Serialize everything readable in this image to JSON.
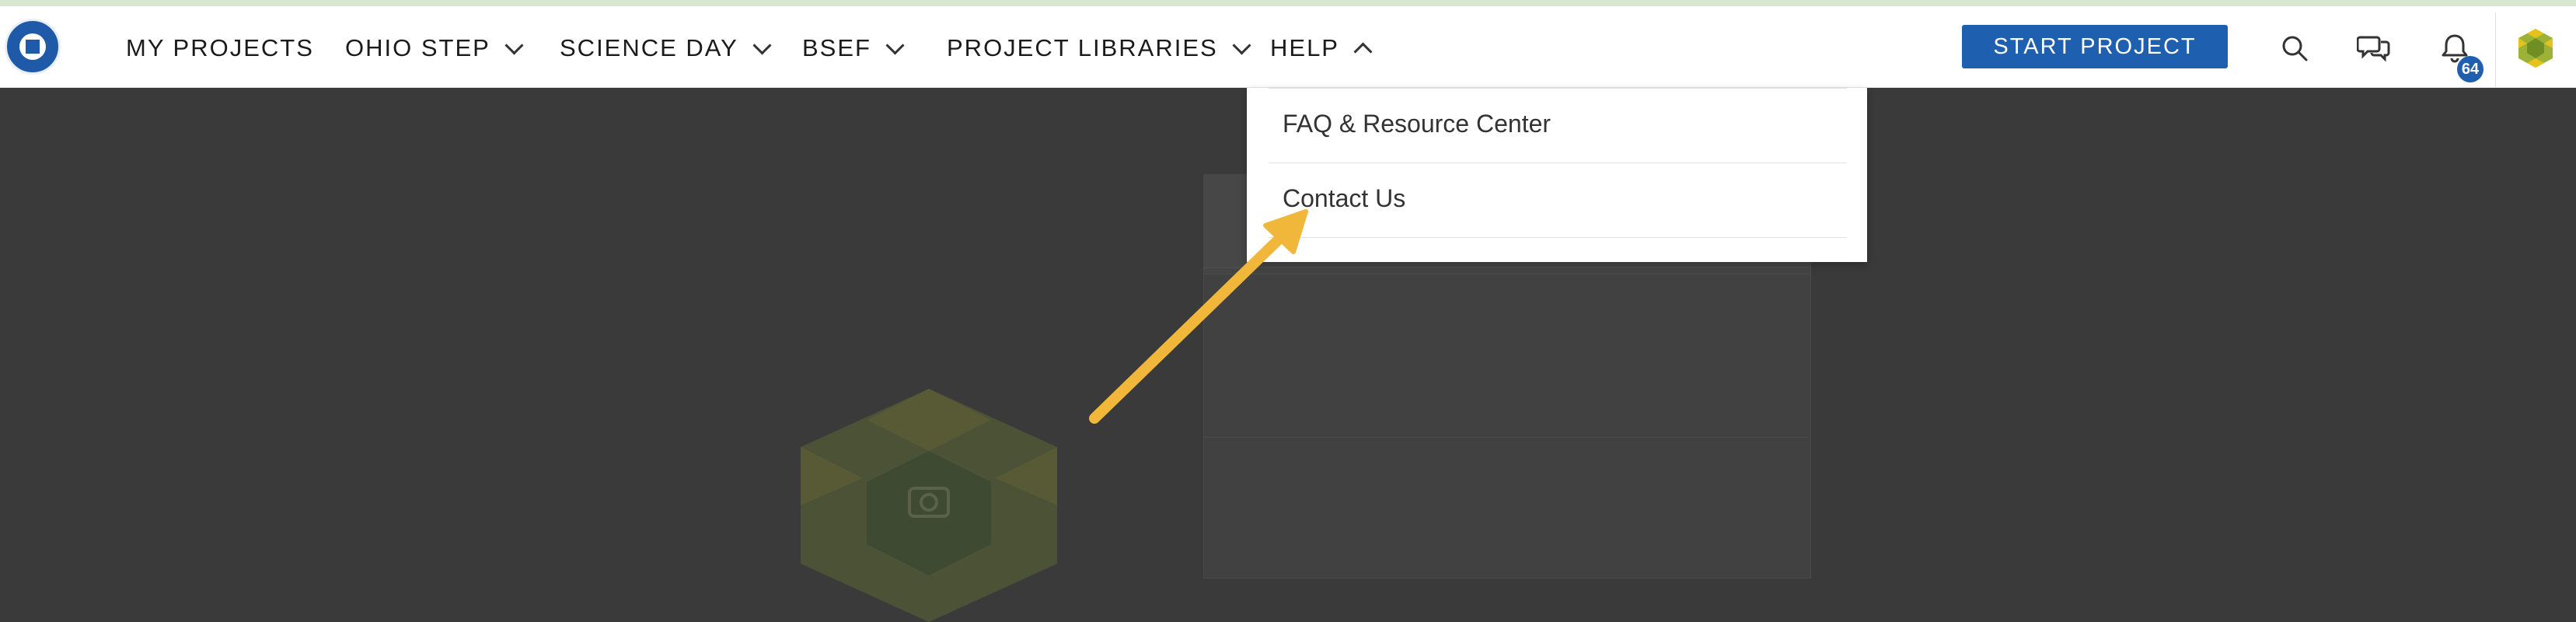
{
  "colors": {
    "accent": "#1f5fb0",
    "annotation_arrow": "#f0b73a",
    "overlay": "#3a3a3a"
  },
  "navbar": {
    "logo_icon": "ohio-academy-of-science-seal",
    "items": [
      {
        "label": "MY PROJECTS",
        "has_dropdown": false
      },
      {
        "label": "OHIO STEP",
        "has_dropdown": true
      },
      {
        "label": "SCIENCE DAY",
        "has_dropdown": true
      },
      {
        "label": "BSEF",
        "has_dropdown": true
      },
      {
        "label": "PROJECT LIBRARIES",
        "has_dropdown": true
      },
      {
        "label": "HELP",
        "has_dropdown": true,
        "expanded": true
      }
    ],
    "start_button": "START PROJECT",
    "icons": [
      "search-icon",
      "chat-bubbles-icon",
      "bell-icon"
    ],
    "notification_count": "64",
    "avatar_icon": "user-avatar"
  },
  "help_menu": {
    "items": [
      {
        "label": "FAQ & Resource Center"
      },
      {
        "label": "Contact Us"
      }
    ]
  }
}
